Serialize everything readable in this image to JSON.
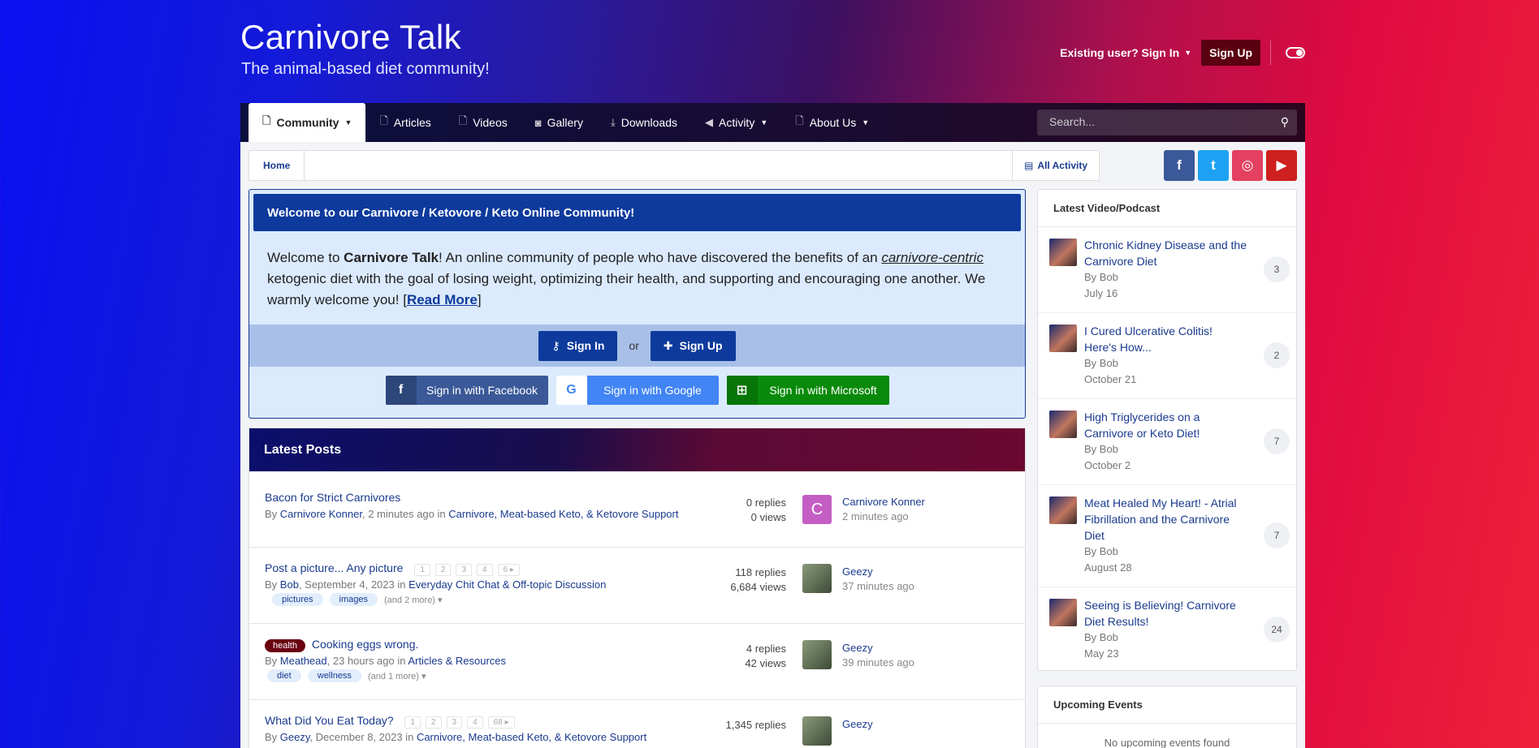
{
  "header": {
    "site_title": "Carnivore Talk",
    "site_subtitle": "The animal-based diet community!",
    "signin_label": "Existing user? Sign In",
    "signup_label": "Sign Up"
  },
  "nav": {
    "items": [
      {
        "label": "Community",
        "icon": "page-icon",
        "dropdown": true
      },
      {
        "label": "Articles",
        "icon": "page-icon"
      },
      {
        "label": "Videos",
        "icon": "page-icon"
      },
      {
        "label": "Gallery",
        "icon": "camera-icon"
      },
      {
        "label": "Downloads",
        "icon": "download-icon"
      },
      {
        "label": "Activity",
        "icon": "megaphone-icon",
        "dropdown": true
      },
      {
        "label": "About Us",
        "icon": "page-icon",
        "dropdown": true
      }
    ],
    "search_placeholder": "Search..."
  },
  "breadcrumb": {
    "home": "Home",
    "all_activity": "All Activity"
  },
  "social_icons": [
    "facebook-icon",
    "twitter-icon",
    "instagram-icon",
    "youtube-icon"
  ],
  "colors": {
    "facebook": "#3b5998",
    "twitter": "#1da1f2",
    "instagram": "#e4405f",
    "youtube": "#cd201f",
    "accent": "#0d3a9c"
  },
  "welcome": {
    "heading": "Welcome to our Carnivore / Ketovore / Keto Online Community!",
    "text_pre": "Welcome to ",
    "text_bold": "Carnivore Talk",
    "text_mid": "! An online community of people who have discovered the benefits of an ",
    "text_ital": "carnivore-centric",
    "text_post": " ketogenic diet with the goal of losing weight, optimizing their health, and supporting and encouraging one another. We warmly welcome you! [",
    "read_more": "Read More",
    "text_end": "]",
    "signin_btn": "Sign In",
    "or": "or",
    "signup_btn": "Sign Up",
    "facebook_btn": "Sign in with Facebook",
    "google_btn": "Sign in with Google",
    "microsoft_btn": "Sign in with Microsoft"
  },
  "latest_posts": {
    "heading": "Latest Posts",
    "posts": [
      {
        "title": "Bacon for Strict Carnivores",
        "by": "By ",
        "author": "Carnivore Konner",
        "time": ", 2 minutes ago in ",
        "forum": "Carnivore, Meat-based Keto, & Ketovore Support",
        "replies": "0 replies",
        "views": "0 views",
        "last_user": "Carnivore Konner",
        "last_time": "2 minutes ago",
        "avatar_letter": "C"
      },
      {
        "title": "Post a picture... Any picture",
        "pages": [
          "1",
          "2",
          "3",
          "4",
          "6 ▸"
        ],
        "by": "By ",
        "author": "Bob",
        "time": ", September 4, 2023 in ",
        "forum": "Everyday Chit Chat & Off-topic Discussion",
        "tags": [
          "pictures",
          "images"
        ],
        "more_tags": "(and 2 more) ▾",
        "replies": "118 replies",
        "views": "6,684 views",
        "last_user": "Geezy",
        "last_time": "37 minutes ago"
      },
      {
        "prefix_tag": "health",
        "title": "Cooking eggs wrong.",
        "by": "By ",
        "author": "Meathead",
        "time": ", 23 hours ago in ",
        "forum": "Articles & Resources",
        "tags": [
          "diet",
          "wellness"
        ],
        "more_tags": "(and 1 more) ▾",
        "replies": "4 replies",
        "views": "42 views",
        "last_user": "Geezy",
        "last_time": "39 minutes ago"
      },
      {
        "title": "What Did You Eat Today?",
        "pages": [
          "1",
          "2",
          "3",
          "4",
          "68 ▸"
        ],
        "by": "By ",
        "author": "Geezy",
        "time": ", December 8, 2023 in ",
        "forum": "Carnivore, Meat-based Keto, & Ketovore Support",
        "replies": "1,345 replies",
        "views": "",
        "last_user": "Geezy",
        "last_time": ""
      }
    ]
  },
  "sidebar": {
    "latest_video_heading": "Latest Video/Podcast",
    "videos": [
      {
        "title": "Chronic Kidney Disease and the Carnivore Diet",
        "by": "By Bob",
        "date": "July 16",
        "count": "3"
      },
      {
        "title": "I Cured Ulcerative Colitis! Here's How...",
        "by": "By Bob",
        "date": "October 21",
        "count": "2"
      },
      {
        "title": "High Triglycerides on a Carnivore or Keto Diet!",
        "by": "By Bob",
        "date": "October 2",
        "count": "7"
      },
      {
        "title": "Meat Healed My Heart! - Atrial Fibrillation and the Carnivore Diet",
        "by": "By Bob",
        "date": "August 28",
        "count": "7"
      },
      {
        "title": "Seeing is Believing! Carnivore Diet Results!",
        "by": "By Bob",
        "date": "May 23",
        "count": "24"
      }
    ],
    "events_heading": "Upcoming Events",
    "events_empty": "No upcoming events found"
  }
}
